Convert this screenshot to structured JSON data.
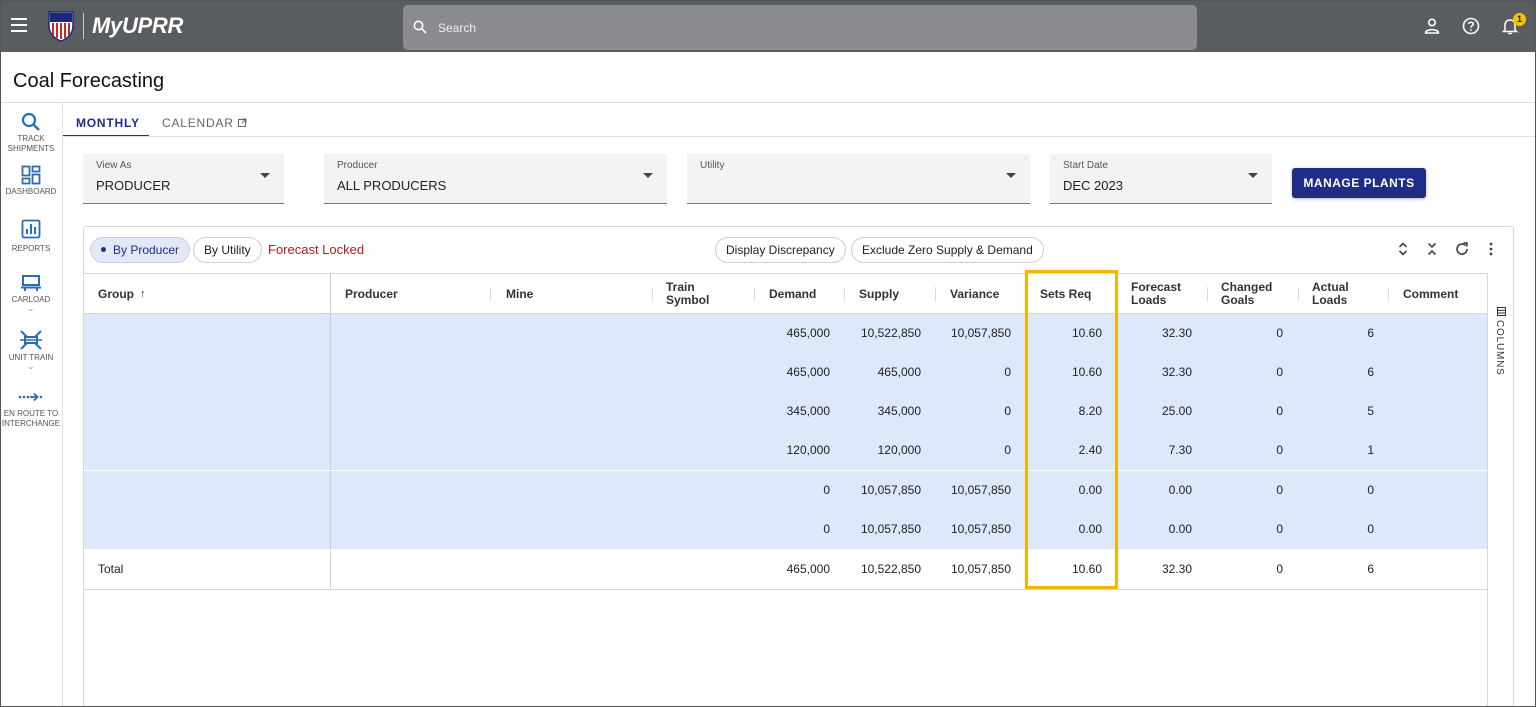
{
  "header": {
    "brand": "MyUPRR",
    "search_placeholder": "Search",
    "notification_count": "1"
  },
  "page": {
    "title": "Coal Forecasting"
  },
  "left_nav": [
    {
      "label": "TRACK SHIPMENTS",
      "icon": "search-icon"
    },
    {
      "label": "DASHBOARD",
      "icon": "dashboard-icon"
    },
    {
      "label": "REPORTS",
      "icon": "reports-icon"
    },
    {
      "label": "CARLOAD",
      "icon": "railcar-icon"
    },
    {
      "label": "UNIT TRAIN",
      "icon": "unit-train-icon"
    },
    {
      "label": "EN ROUTE TO INTERCHANGE",
      "icon": "en-route-icon"
    }
  ],
  "tabs": {
    "monthly": "MONTHLY",
    "calendar": "CALENDAR"
  },
  "filters": {
    "view_as": {
      "label": "View As",
      "value": "PRODUCER"
    },
    "producer": {
      "label": "Producer",
      "value": "ALL PRODUCERS"
    },
    "utility": {
      "label": "Utility",
      "value": ""
    },
    "start_date": {
      "label": "Start Date",
      "value": "DEC 2023"
    },
    "manage_plants": "MANAGE PLANTS"
  },
  "grid": {
    "chips": {
      "by_producer": "By Producer",
      "by_utility": "By Utility",
      "display_discrepancy": "Display Discrepancy",
      "exclude_zero": "Exclude Zero Supply & Demand"
    },
    "status": "Forecast Locked",
    "columns_panel": "COLUMNS",
    "columns": {
      "group": "Group",
      "producer": "Producer",
      "mine": "Mine",
      "train_symbol": "Train Symbol",
      "demand": "Demand",
      "supply": "Supply",
      "variance": "Variance",
      "sets_req": "Sets Req",
      "forecast_loads": "Forecast Loads",
      "changed_goals": "Changed Goals",
      "actual_loads": "Actual Loads",
      "comment": "Comment"
    },
    "rows": [
      {
        "demand": "465,000",
        "supply": "10,522,850",
        "variance": "10,057,850",
        "sets_req": "10.60",
        "forecast_loads": "32.30",
        "changed_goals": "0",
        "actual_loads": "6"
      },
      {
        "demand": "465,000",
        "supply": "465,000",
        "variance": "0",
        "sets_req": "10.60",
        "forecast_loads": "32.30",
        "changed_goals": "0",
        "actual_loads": "6"
      },
      {
        "demand": "345,000",
        "supply": "345,000",
        "variance": "0",
        "sets_req": "8.20",
        "forecast_loads": "25.00",
        "changed_goals": "0",
        "actual_loads": "5"
      },
      {
        "demand": "120,000",
        "supply": "120,000",
        "variance": "0",
        "sets_req": "2.40",
        "forecast_loads": "7.30",
        "changed_goals": "0",
        "actual_loads": "1"
      },
      {
        "demand": "0",
        "supply": "10,057,850",
        "variance": "10,057,850",
        "sets_req": "0.00",
        "forecast_loads": "0.00",
        "changed_goals": "0",
        "actual_loads": "0"
      },
      {
        "demand": "0",
        "supply": "10,057,850",
        "variance": "10,057,850",
        "sets_req": "0.00",
        "forecast_loads": "0.00",
        "changed_goals": "0",
        "actual_loads": "0"
      }
    ],
    "total": {
      "group": "Total",
      "demand": "465,000",
      "supply": "10,522,850",
      "variance": "10,057,850",
      "sets_req": "10.60",
      "forecast_loads": "32.30",
      "changed_goals": "0",
      "actual_loads": "6"
    }
  },
  "colors": {
    "topbar": "#5a5d60",
    "primary": "#1f2d86",
    "selected_row": "#dde8fb",
    "locked_text": "#b71c1c",
    "highlight": "#f2b600"
  }
}
